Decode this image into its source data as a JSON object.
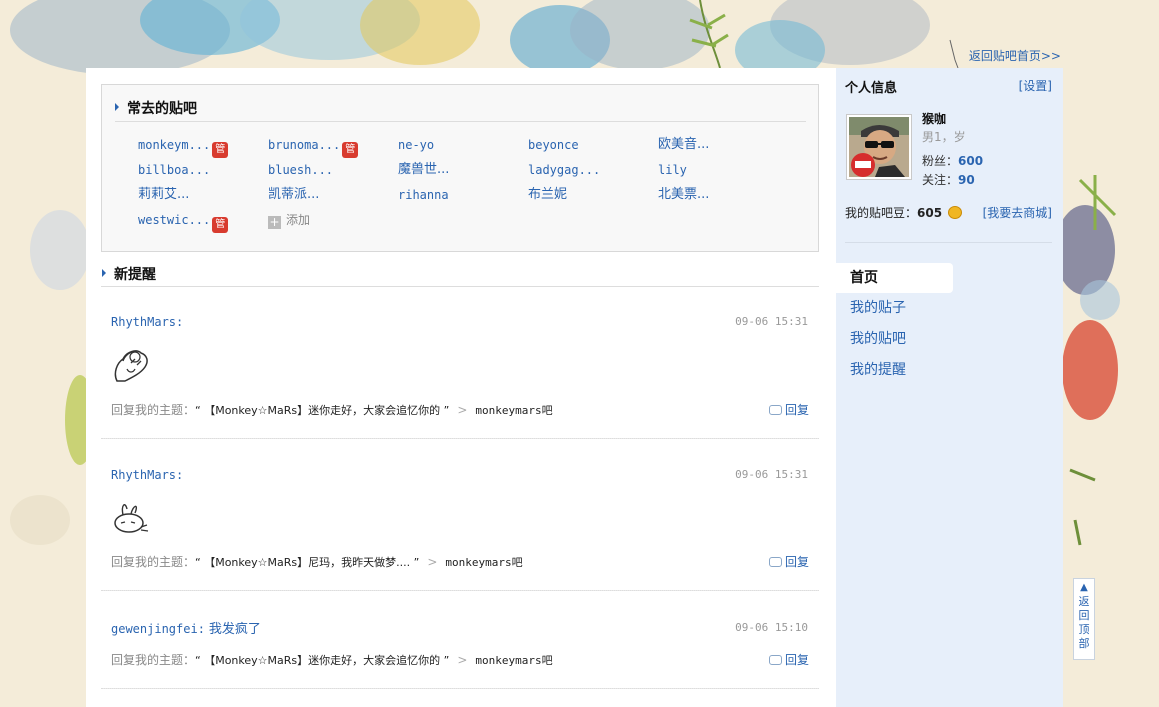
{
  "header": {
    "back_home": "返回贴吧首页>>"
  },
  "favorites": {
    "title": "常去的贴吧",
    "add_label": "添加",
    "badge_label": "管",
    "items": [
      {
        "name": "monkeym...",
        "badge": true
      },
      {
        "name": "brunoma...",
        "badge": true
      },
      {
        "name": "ne-yo",
        "badge": false
      },
      {
        "name": "beyonce",
        "badge": false
      },
      {
        "name": "欧美音...",
        "badge": false
      },
      {
        "name": "billboa...",
        "badge": false
      },
      {
        "name": "bluesh...",
        "badge": false
      },
      {
        "name": "魔兽世...",
        "badge": false
      },
      {
        "name": "ladygag...",
        "badge": false
      },
      {
        "name": "lily",
        "badge": false
      },
      {
        "name": "莉莉艾...",
        "badge": false
      },
      {
        "name": "凯蒂派...",
        "badge": false
      },
      {
        "name": "rihanna",
        "badge": false
      },
      {
        "name": "布兰妮",
        "badge": false
      },
      {
        "name": "北美票...",
        "badge": false
      },
      {
        "name": "westwic...",
        "badge": true
      }
    ]
  },
  "reminders": {
    "title": "新提醒",
    "reply_label": "回复",
    "prefix": "回复我的主题：",
    "items": [
      {
        "user": "RhythMars:",
        "text": "",
        "time": "09-06 15:31",
        "topic": "“ 【Monkey☆MaRs】迷你走好，大家会追忆你的 ”",
        "forum": "monkeymars吧",
        "emoji": "monkey-emoji-1"
      },
      {
        "user": "RhythMars:",
        "text": "",
        "time": "09-06 15:31",
        "topic": "“ 【Monkey☆MaRs】尼玛，我昨天做梦.... ”",
        "forum": "monkeymars吧",
        "emoji": "monkey-emoji-2"
      },
      {
        "user": "gewenjingfei:",
        "text": "我发疯了",
        "time": "09-06 15:10",
        "topic": "“ 【Monkey☆MaRs】迷你走好，大家会追忆你的 ”",
        "forum": "monkeymars吧",
        "emoji": ""
      }
    ]
  },
  "profile": {
    "title": "个人信息",
    "settings": "[设置]",
    "name": "猴咖",
    "gender": "男1，岁",
    "fans_label": "粉丝：",
    "fans": "600",
    "follow_label": "关注：",
    "follow": "90",
    "beans_label": "我的贴吧豆：",
    "beans": "605",
    "shop": "[我要去商城]"
  },
  "nav": {
    "items": [
      {
        "label": "首页",
        "active": true
      },
      {
        "label": "我的贴子",
        "active": false
      },
      {
        "label": "我的贴吧",
        "active": false
      },
      {
        "label": "我的提醒",
        "active": false
      }
    ]
  },
  "to_top": {
    "label": "返回顶部"
  },
  "colors": {
    "link": "#2a64b0",
    "badge": "#d83b2f",
    "sidebar_bg": "#e7effa",
    "page_bg": "#f4ecd9"
  }
}
